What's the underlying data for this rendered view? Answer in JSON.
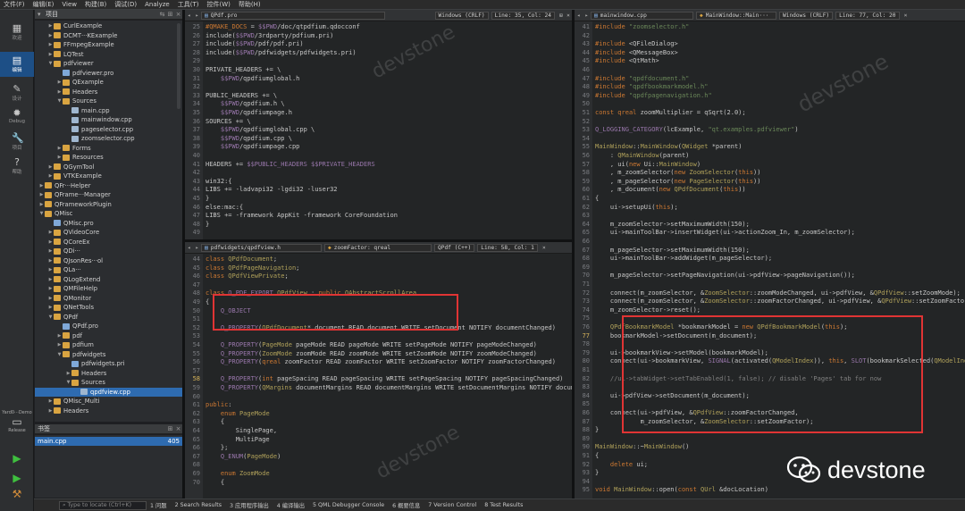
{
  "menubar": {
    "items": [
      "文件(F)",
      "编辑(E)",
      "View",
      "构建(B)",
      "调试(D)",
      "Analyze",
      "工具(T)",
      "控件(W)",
      "帮助(H)"
    ]
  },
  "modes": [
    {
      "label": "欢迎",
      "icon": "grid-icon"
    },
    {
      "label": "编辑",
      "icon": "edit-icon"
    },
    {
      "label": "设计",
      "icon": "pen-icon"
    },
    {
      "label": "Debug",
      "icon": "bug-icon"
    },
    {
      "label": "项目",
      "icon": "wrench-icon"
    },
    {
      "label": "帮助",
      "icon": "help-icon"
    }
  ],
  "kit": {
    "name": "Yard0···Demo",
    "config": "Release"
  },
  "project_panel": {
    "title": "项目"
  },
  "tree": [
    {
      "d": 1,
      "t": "CurlExample",
      "k": "folder",
      "a": "r"
    },
    {
      "d": 1,
      "t": "DCMT···KExample",
      "k": "folder",
      "a": "r"
    },
    {
      "d": 1,
      "t": "FFmpegExample",
      "k": "folder",
      "a": "r"
    },
    {
      "d": 1,
      "t": "LQTest",
      "k": "folder",
      "a": "r"
    },
    {
      "d": 1,
      "t": "pdfviewer",
      "k": "folder",
      "a": "d"
    },
    {
      "d": 2,
      "t": "pdfviewer.pro",
      "k": "pro",
      "a": ""
    },
    {
      "d": 2,
      "t": "QExample",
      "k": "folder",
      "a": "r"
    },
    {
      "d": 2,
      "t": "Headers",
      "k": "folder",
      "a": "r"
    },
    {
      "d": 2,
      "t": "Sources",
      "k": "folder",
      "a": "d"
    },
    {
      "d": 3,
      "t": "main.cpp",
      "k": "file",
      "a": ""
    },
    {
      "d": 3,
      "t": "mainwindow.cpp",
      "k": "file",
      "a": ""
    },
    {
      "d": 3,
      "t": "pageselector.cpp",
      "k": "file",
      "a": ""
    },
    {
      "d": 3,
      "t": "zoomselector.cpp",
      "k": "file",
      "a": ""
    },
    {
      "d": 2,
      "t": "Forms",
      "k": "folder",
      "a": "r"
    },
    {
      "d": 2,
      "t": "Resources",
      "k": "folder",
      "a": "r"
    },
    {
      "d": 1,
      "t": "QGymTool",
      "k": "folder",
      "a": "r"
    },
    {
      "d": 1,
      "t": "VTKExample",
      "k": "folder",
      "a": "r"
    },
    {
      "d": 0,
      "t": "QFr···Helper",
      "k": "folder",
      "a": "r"
    },
    {
      "d": 0,
      "t": "QFrame···Manager",
      "k": "folder",
      "a": "r"
    },
    {
      "d": 0,
      "t": "QFrameworkPlugin",
      "k": "folder",
      "a": "r"
    },
    {
      "d": 0,
      "t": "QMisc",
      "k": "folder",
      "a": "d"
    },
    {
      "d": 1,
      "t": "QMisc.pro",
      "k": "pro",
      "a": ""
    },
    {
      "d": 1,
      "t": "QVideoCore",
      "k": "folder",
      "a": "r"
    },
    {
      "d": 1,
      "t": "QCoreEx",
      "k": "folder",
      "a": "r"
    },
    {
      "d": 1,
      "t": "QDi···",
      "k": "folder",
      "a": "r"
    },
    {
      "d": 1,
      "t": "QJsonRes···ol",
      "k": "folder",
      "a": "r"
    },
    {
      "d": 1,
      "t": "QLa···",
      "k": "folder",
      "a": "r"
    },
    {
      "d": 1,
      "t": "QLogExtend",
      "k": "folder",
      "a": "r"
    },
    {
      "d": 1,
      "t": "QMFileHelp",
      "k": "folder",
      "a": "r"
    },
    {
      "d": 1,
      "t": "QMonitor",
      "k": "folder",
      "a": "r"
    },
    {
      "d": 1,
      "t": "QNetTools",
      "k": "folder",
      "a": "r"
    },
    {
      "d": 1,
      "t": "QPdf",
      "k": "folder",
      "a": "d"
    },
    {
      "d": 2,
      "t": "QPdf.pro",
      "k": "pro",
      "a": ""
    },
    {
      "d": 2,
      "t": "pdf",
      "k": "folder",
      "a": "r"
    },
    {
      "d": 2,
      "t": "pdfium",
      "k": "folder",
      "a": "r"
    },
    {
      "d": 2,
      "t": "pdfwidgets",
      "k": "folder",
      "a": "d"
    },
    {
      "d": 3,
      "t": "pdfwidgets.pri",
      "k": "pro",
      "a": ""
    },
    {
      "d": 3,
      "t": "Headers",
      "k": "folder",
      "a": "r"
    },
    {
      "d": 3,
      "t": "Sources",
      "k": "folder",
      "a": "d"
    },
    {
      "d": 4,
      "t": "qpdfview.cpp",
      "k": "file",
      "a": "",
      "sel": true
    },
    {
      "d": 1,
      "t": "QMisc_Multi",
      "k": "folder",
      "a": "r"
    },
    {
      "d": 1,
      "t": "Headers",
      "k": "folder",
      "a": "r"
    }
  ],
  "bookmarks": {
    "title": "书签",
    "file": "main.cpp",
    "line": "405"
  },
  "statusbar": {
    "locate_placeholder": "Type to locate (Ctrl+K)",
    "items": [
      "1 问题",
      "2 Search Results",
      "3 应用程序输出",
      "4 编译输出",
      "5 QML Debugger Console",
      "6 概要信息",
      "7 Version Control",
      "8 Test Results"
    ]
  },
  "editors": {
    "top_left": {
      "file": "QPdf.pro",
      "encoding": "Windows (CRLF)",
      "position": "Line: 35, Col: 24",
      "start": 25,
      "lines": [
        "#QMAKE_DOCS = $$PWD/doc/qtpdfium.qdocconf",
        "include($$PWD/3rdparty/pdfium.pri)",
        "include($$PWD/pdf/pdf.pri)",
        "include($$PWD/pdfwidgets/pdfwidgets.pri)",
        "",
        "PRIVATE_HEADERS += \\",
        "    $$PWD/qpdfiumglobal.h",
        "",
        "PUBLIC_HEADERS += \\",
        "    $$PWD/qpdfium.h \\",
        "    $$PWD/qpdfiumpage.h",
        "SOURCES += \\",
        "    $$PWD/qpdfiumglobal.cpp \\",
        "    $$PWD/qpdfium.cpp \\",
        "    $$PWD/qpdfiumpage.cpp",
        "",
        "HEADERS += $$PUBLIC_HEADERS $$PRIVATE_HEADERS",
        "",
        "win32:{",
        "LIBS += -ladvapi32 -lgdi32 -luser32",
        "}",
        "else:mac:{",
        "LIBS += -framework AppKit -framework CoreFoundation",
        "}",
        ""
      ]
    },
    "bottom_left": {
      "file": "pdfwidgets/qpdfview.h",
      "symbol": "zoomFactor: qreal",
      "lang": "QPdf (C++)",
      "position": "Line: 58, Col: 1",
      "start": 44,
      "current": 58,
      "lines": [
        "class QPdfDocument;",
        "class QPdfPageNavigation;",
        "class QPdfViewPrivate;",
        "",
        "class Q_PDF_EXPORT QPdfView : public QAbstractScrollArea",
        "{",
        "    Q_OBJECT",
        "",
        "    Q_PROPERTY(QPdfDocument* document READ document WRITE setDocument NOTIFY documentChanged)",
        "",
        "    Q_PROPERTY(PageMode pageMode READ pageMode WRITE setPageMode NOTIFY pageModeChanged)",
        "    Q_PROPERTY(ZoomMode zoomMode READ zoomMode WRITE setZoomMode NOTIFY zoomModeChanged)",
        "    Q_PROPERTY(qreal zoomFactor READ zoomFactor WRITE setZoomFactor NOTIFY zoomFactorChanged)",
        "",
        "    Q_PROPERTY(int pageSpacing READ pageSpacing WRITE setPageSpacing NOTIFY pageSpacingChanged)",
        "    Q_PROPERTY(QMargins documentMargins READ documentMargins WRITE setDocumentMargins NOTIFY documentMarginsChanged)",
        "",
        "public:",
        "    enum PageMode",
        "    {",
        "        SinglePage,",
        "        MultiPage",
        "    };",
        "    Q_ENUM(PageMode)",
        "",
        "    enum ZoomMode",
        "    {"
      ]
    },
    "right": {
      "file": "mainwindow.cpp",
      "symbol": "MainWindow::Main···",
      "encoding": "Windows (CRLF)",
      "position": "Line: 77, Col: 20",
      "start": 41,
      "current": 77,
      "lines": [
        "#include \"zoomselector.h\"",
        "",
        "#include <QFileDialog>",
        "#include <QMessageBox>",
        "#include <QtMath>",
        "",
        "#include \"qpdfdocument.h\"",
        "#include \"qpdfbookmarkmodel.h\"",
        "#include \"qpdfpagenavigation.h\"",
        "",
        "const qreal zoomMultiplier = qSqrt(2.0);",
        "",
        "Q_LOGGING_CATEGORY(lcExample, \"qt.examples.pdfviewer\")",
        "",
        "MainWindow::MainWindow(QWidget *parent)",
        "    : QMainWindow(parent)",
        "    , ui(new Ui::MainWindow)",
        "    , m_zoomSelector(new ZoomSelector(this))",
        "    , m_pageSelector(new PageSelector(this))",
        "    , m_document(new QPdfDocument(this))",
        "{",
        "    ui->setupUi(this);",
        "",
        "    m_zoomSelector->setMaximumWidth(150);",
        "    ui->mainToolBar->insertWidget(ui->actionZoom_In, m_zoomSelector);",
        "",
        "    m_pageSelector->setMaximumWidth(150);",
        "    ui->mainToolBar->addWidget(m_pageSelector);",
        "",
        "    m_pageSelector->setPageNavigation(ui->pdfView->pageNavigation());",
        "",
        "    connect(m_zoomSelector, &ZoomSelector::zoomModeChanged, ui->pdfView, &QPdfView::setZoomMode);",
        "    connect(m_zoomSelector, &ZoomSelector::zoomFactorChanged, ui->pdfView, &QPdfView::setZoomFactor);",
        "    m_zoomSelector->reset();",
        "",
        "    QPdfBookmarkModel *bookmarkModel = new QPdfBookmarkModel(this);",
        "    bookmarkModel->setDocument(m_document);",
        "",
        "    ui->bookmarkView->setModel(bookmarkModel);",
        "    connect(ui->bookmarkView, SIGNAL(activated(QModelIndex)), this, SLOT(bookmarkSelected(QModelIndex)));",
        "",
        "    //ui->tabWidget->setTabEnabled(1, false); // disable 'Pages' tab for now",
        "",
        "    ui->pdfView->setDocument(m_document);",
        "",
        "    connect(ui->pdfView, &QPdfView::zoomFactorChanged,",
        "            m_zoomSelector, &ZoomSelector::setZoomFactor);",
        "}",
        "",
        "MainWindow::~MainWindow()",
        "{",
        "    delete ui;",
        "}",
        "",
        "void MainWindow::open(const QUrl &docLocation)"
      ]
    }
  },
  "watermark": "devstone",
  "brand": {
    "name": "devstone"
  },
  "colors": {
    "keyword": "#cc7832",
    "type": "#b0a15a",
    "string": "#6a8759",
    "macro": "#9876aa",
    "highlight": "#e03434",
    "selection": "#2e6bb0"
  }
}
